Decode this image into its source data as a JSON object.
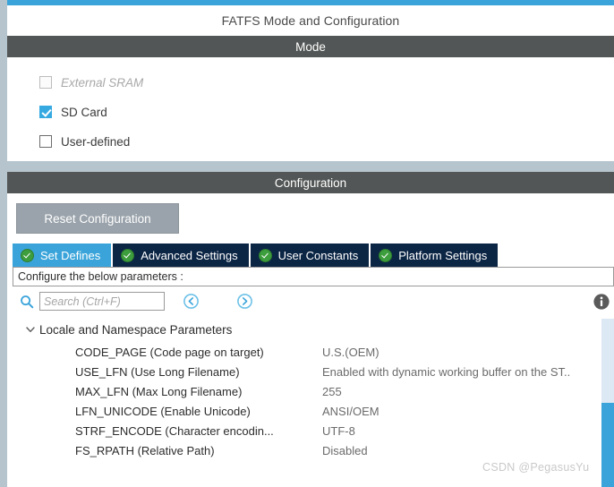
{
  "window": {
    "title": "FATFS Mode and Configuration",
    "accent_color": "#3aa4da",
    "rail_color": "#b6c4cd"
  },
  "mode_section": {
    "header": "Mode",
    "options": [
      {
        "label": "External SRAM",
        "checked": false,
        "disabled": true
      },
      {
        "label": "SD Card",
        "checked": true,
        "disabled": false
      },
      {
        "label": "User-defined",
        "checked": false,
        "disabled": false
      }
    ]
  },
  "configuration_section": {
    "header": "Configuration",
    "reset_button": "Reset Configuration",
    "tabs": [
      {
        "label": "Set Defines",
        "active": true,
        "icon": "check-circle-icon"
      },
      {
        "label": "Advanced Settings",
        "active": false,
        "icon": "check-circle-icon"
      },
      {
        "label": "User Constants",
        "active": false,
        "icon": "check-circle-icon"
      },
      {
        "label": "Platform Settings",
        "active": false,
        "icon": "check-circle-icon"
      }
    ],
    "hint": "Configure the below parameters :",
    "search": {
      "placeholder": "Search (Ctrl+F)",
      "value": "",
      "icon": "search-icon",
      "prev_icon": "chevron-left-circle-icon",
      "next_icon": "chevron-right-circle-icon",
      "info_icon": "info-icon"
    },
    "tree": {
      "group_label": "Locale and Namespace Parameters",
      "group_expanded": true,
      "expander_icon": "chevron-down-icon",
      "rows": [
        {
          "name": "CODE_PAGE (Code page on target)",
          "value": "U.S.(OEM)"
        },
        {
          "name": "USE_LFN (Use Long Filename)",
          "value": "Enabled with dynamic working buffer on the ST.."
        },
        {
          "name": "MAX_LFN (Max Long Filename)",
          "value": "255"
        },
        {
          "name": "LFN_UNICODE (Enable Unicode)",
          "value": "ANSI/OEM"
        },
        {
          "name": "STRF_ENCODE (Character encodin...",
          "value": "UTF-8"
        },
        {
          "name": "FS_RPATH (Relative Path)",
          "value": "Disabled"
        }
      ],
      "scrollbar": {
        "track_color": "#dce9f4",
        "thumb_color": "#3aa4da"
      }
    }
  },
  "watermark": "CSDN @PegasusYu"
}
